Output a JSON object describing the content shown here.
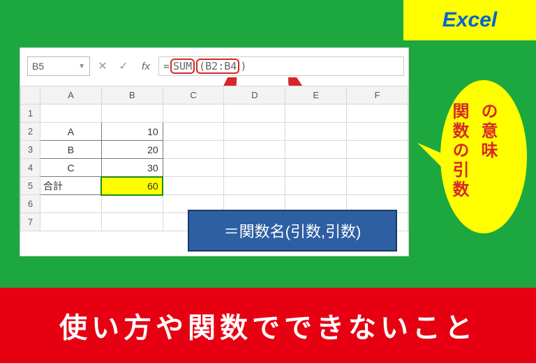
{
  "badge": {
    "label": "Excel"
  },
  "excel": {
    "nameBox": "B5",
    "formula": {
      "prefix": "=",
      "func": "SUM",
      "args": "B2:B4",
      "close": ")"
    },
    "columns": [
      "A",
      "B",
      "C",
      "D",
      "E",
      "F"
    ],
    "rows": [
      {
        "n": "1",
        "a": "",
        "b": ""
      },
      {
        "n": "2",
        "a": "A",
        "b": "10"
      },
      {
        "n": "3",
        "a": "B",
        "b": "20"
      },
      {
        "n": "4",
        "a": "C",
        "b": "30"
      },
      {
        "n": "5",
        "a": "合計",
        "b": "60"
      },
      {
        "n": "6",
        "a": "",
        "b": ""
      },
      {
        "n": "7",
        "a": "",
        "b": ""
      }
    ],
    "labels": {
      "func": "関数",
      "args": "引数"
    },
    "syntax": "＝関数名(引数,引数)"
  },
  "bubble": {
    "line1": "関数の引数",
    "line2": "の意味"
  },
  "footer": "使い方や関数でできないこと"
}
